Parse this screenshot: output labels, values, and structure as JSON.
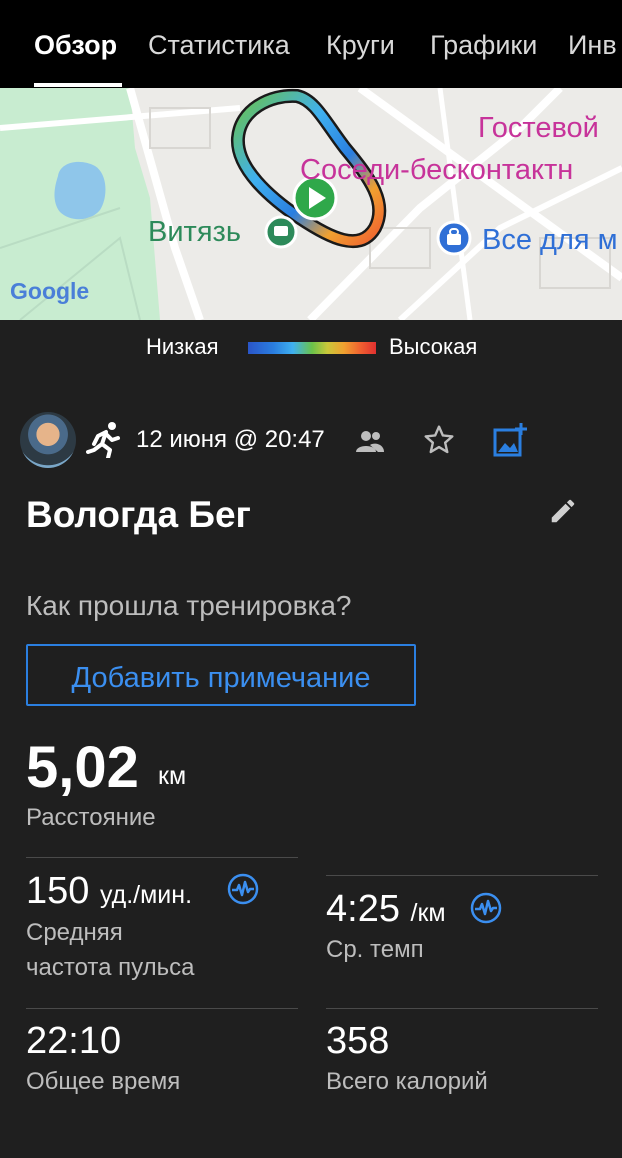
{
  "tabs": [
    "Обзор",
    "Статистика",
    "Круги",
    "Графики",
    "Инв"
  ],
  "map": {
    "labels": {
      "guest": "Гостевой",
      "neighbors": "Соседи-бесконтактн",
      "vityaz": "Витязь",
      "store": "Все для м"
    },
    "google_logo": "Google"
  },
  "legend": {
    "low": "Низкая",
    "high": "Высокая"
  },
  "activity": {
    "date": "12 июня @ 20:47",
    "title": "Вологда Бег",
    "question": "Как прошла тренировка?",
    "add_note": "Добавить примечание"
  },
  "stats": {
    "distance": {
      "value": "5,02",
      "unit": "км",
      "label": "Расстояние"
    },
    "avg_hr": {
      "value": "150",
      "unit": "уд./мин.",
      "label1": "Средняя",
      "label2": "частота пульса"
    },
    "avg_pace": {
      "value": "4:25",
      "unit": "/км",
      "label": "Ср. темп"
    },
    "total_time": {
      "value": "22:10",
      "label": "Общее время"
    },
    "calories": {
      "value": "358",
      "label": "Всего калорий"
    }
  },
  "colors": {
    "accent": "#2b7fe0",
    "map_text_pink": "#c7339a",
    "map_text_green": "#2d8a5a",
    "map_text_blue": "#2f6fd6"
  }
}
